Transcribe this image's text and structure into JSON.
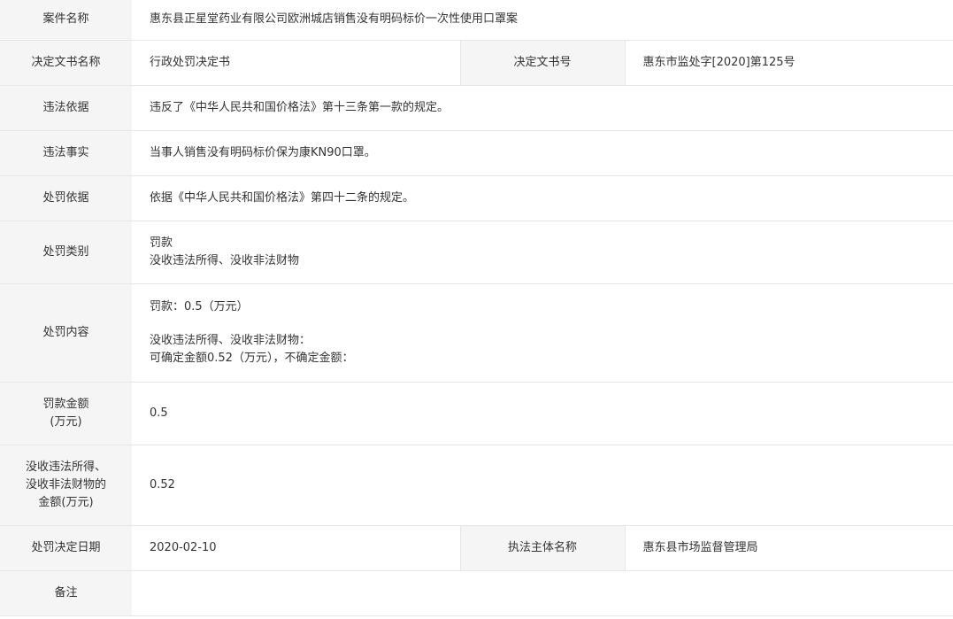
{
  "rows": {
    "case_name": {
      "label": "案件名称",
      "value": "惠东县正星堂药业有限公司欧洲城店销售没有明码标价一次性使用口罩案"
    },
    "decision_doc": {
      "label": "决定文书名称",
      "value": "行政处罚决定书",
      "label2": "决定文书号",
      "value2": "惠东市监处字[2020]第125号"
    },
    "violation_basis": {
      "label": "违法依据",
      "value": "违反了《中华人民共和国价格法》第十三条第一款的规定。"
    },
    "violation_facts": {
      "label": "违法事实",
      "value": "当事人销售没有明码标价保为康KN90口罩。"
    },
    "penalty_basis": {
      "label": "处罚依据",
      "value": "依据《中华人民共和国价格法》第四十二条的规定。"
    },
    "penalty_type": {
      "label": "处罚类别",
      "line1": "罚款",
      "line2": "没收违法所得、没收非法财物"
    },
    "penalty_content": {
      "label": "处罚内容",
      "line1": "罚款：0.5（万元）",
      "line2": "没收违法所得、没收非法财物：",
      "line3": "可确定金额0.52（万元），不确定金额："
    },
    "fine_amount": {
      "label_line1": "罚款金额",
      "label_line2": "(万元)",
      "value": "0.5"
    },
    "confiscation_amount": {
      "label_line1": "没收违法所得、",
      "label_line2": "没收非法财物的",
      "label_line3": "金额(万元)",
      "value": "0.52"
    },
    "decision_date": {
      "label": "处罚决定日期",
      "value": "2020-02-10",
      "label2": "执法主体名称",
      "value2": "惠东县市场监督管理局"
    },
    "remarks": {
      "label": "备注",
      "value": ""
    }
  },
  "colors": {
    "label_bg": "#f5f5f5",
    "border": "#e6e6e6",
    "text": "#333333"
  }
}
